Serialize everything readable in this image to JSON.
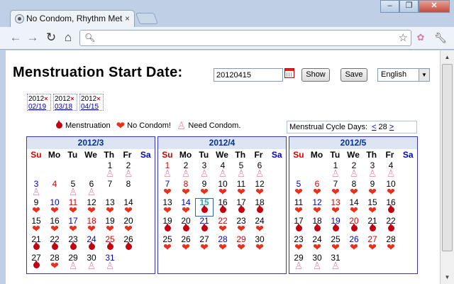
{
  "browser": {
    "tab_title": "No Condom, Rhythm Met",
    "tab_close": "×",
    "url": "",
    "window_buttons": [
      "–",
      "❐",
      "✕"
    ]
  },
  "page": {
    "title": "Menstruation Start Date:",
    "date_value": "20120415",
    "show_label": "Show",
    "save_label": "Save",
    "language": "English",
    "history": [
      {
        "year": "2012",
        "date": "02/19",
        "remove": "×"
      },
      {
        "year": "2012",
        "date": "03/18",
        "remove": "×"
      },
      {
        "year": "2012",
        "date": "04/15",
        "remove": "×"
      }
    ],
    "legend": [
      {
        "icon": "blood-drop-icon",
        "label": "Menstruation"
      },
      {
        "icon": "hearts-icon",
        "label": "No Condom!"
      },
      {
        "icon": "condom-icon",
        "label": "Need Condom."
      }
    ],
    "cycle_label": "Menstrual Cycle Days:",
    "cycle_prev": "<",
    "cycle_value": "28",
    "cycle_next": ">",
    "weekdays": [
      "Su",
      "Mo",
      "Tu",
      "We",
      "Th",
      "Fr",
      "Sa"
    ],
    "months": [
      {
        "title": "2012/3",
        "lead": 4,
        "days": 31,
        "marks": "ppp.pp..hhhhhhhhhhhhmmmmmmmhppppp"
      },
      {
        "title": "2012/4",
        "lead": 0,
        "days": 30,
        "today": 15,
        "marks": "pppppphhhhhhhhmmmmmmmhhhhhhhhhp"
      },
      {
        "title": "2012/5",
        "lead": 2,
        "days": 31,
        "marks": "pppphhhhhhhhhhhmmmmmmmhhhhhhppppp"
      }
    ]
  },
  "colors": {
    "menstruation": "#c40010",
    "hearts": "#e8301c",
    "condom": "#ee8fb6",
    "accent": "#3333cc"
  }
}
